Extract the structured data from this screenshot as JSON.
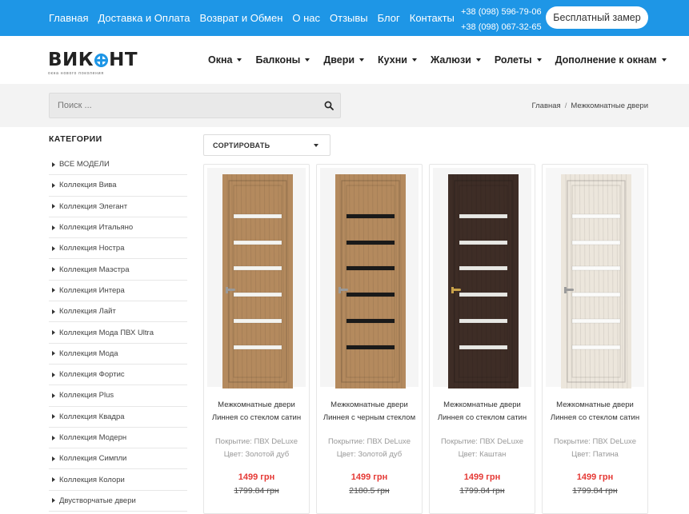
{
  "topbar": {
    "links": [
      "Главная",
      "Доставка и Оплата",
      "Возврат и Обмен",
      "О нас",
      "Отзывы",
      "Блог",
      "Контакты"
    ],
    "phone1": "+38 (098) 596-79-06",
    "phone2": "+38 (098) 067-32-65",
    "measure_button": "Бесплатный замер",
    "color": "#1e96e6"
  },
  "logo": {
    "word_start": "ВИК",
    "word_end": "НТ",
    "tagline": "окна нового поколения"
  },
  "mainnav": [
    "Окна",
    "Балконы",
    "Двери",
    "Кухни",
    "Жалюзи",
    "Ролеты",
    "Дополнение к окнам"
  ],
  "search": {
    "placeholder": "Поиск ..."
  },
  "breadcrumb": {
    "home": "Главная",
    "sep": "/",
    "current": "Межкомнатные двери"
  },
  "sidebar": {
    "title": "КАТЕГОРИИ",
    "items": [
      "ВСЕ МОДЕЛИ",
      "Коллекция Вива",
      "Коллекция Элегант",
      "Коллекция Итальяно",
      "Коллекция Нострa",
      "Коллекция Маэстра",
      "Коллекция Интера",
      "Коллекция Лайт",
      "Коллекция Мода ПВХ Ultra",
      "Коллекция Мода",
      "Коллекция Фортис",
      "Коллекция Plus",
      "Коллекция Квадра",
      "Коллекция Модерн",
      "Коллекция Симпли",
      "Коллекция Колори",
      "Двустворчатые двери"
    ]
  },
  "sort": {
    "label": "СОРТИРОВАТЬ"
  },
  "products": [
    {
      "name1": "Межкомнатные двери",
      "name2": "Линнея со стеклом сатин",
      "coating": "Покрытие: ПВХ DeLuxe",
      "color_label": "Цвет: Золотой дуб",
      "price": "1499 грн",
      "old_price": "1799.84 грн",
      "wood": "#b48a5e",
      "glass": "#f4f4f0",
      "handle": "#9a9a9a"
    },
    {
      "name1": "Межкомнатные двери",
      "name2": "Линнея с черным стеклом",
      "coating": "Покрытие: ПВХ DeLuxe",
      "color_label": "Цвет: Золотой дуб",
      "price": "1499 грн",
      "old_price": "2180.5 грн",
      "wood": "#b48a5e",
      "glass": "#1a1a1a",
      "handle": "#9a9a9a"
    },
    {
      "name1": "Межкомнатные двери",
      "name2": "Линнея со стеклом сатин",
      "coating": "Покрытие: ПВХ DeLuxe",
      "color_label": "Цвет: Каштан",
      "price": "1499 грн",
      "old_price": "1799.84 грн",
      "wood": "#3e2d26",
      "glass": "#e8e8e4",
      "handle": "#c9a24a"
    },
    {
      "name1": "Межкомнатные двери",
      "name2": "Линнея со стеклом сатин",
      "coating": "Покрытие: ПВХ DeLuxe",
      "color_label": "Цвет: Патина",
      "price": "1499 грн",
      "old_price": "1799.84 грн",
      "wood": "#ece6dc",
      "glass": "#fbfbfa",
      "handle": "#9a9a9a"
    }
  ]
}
